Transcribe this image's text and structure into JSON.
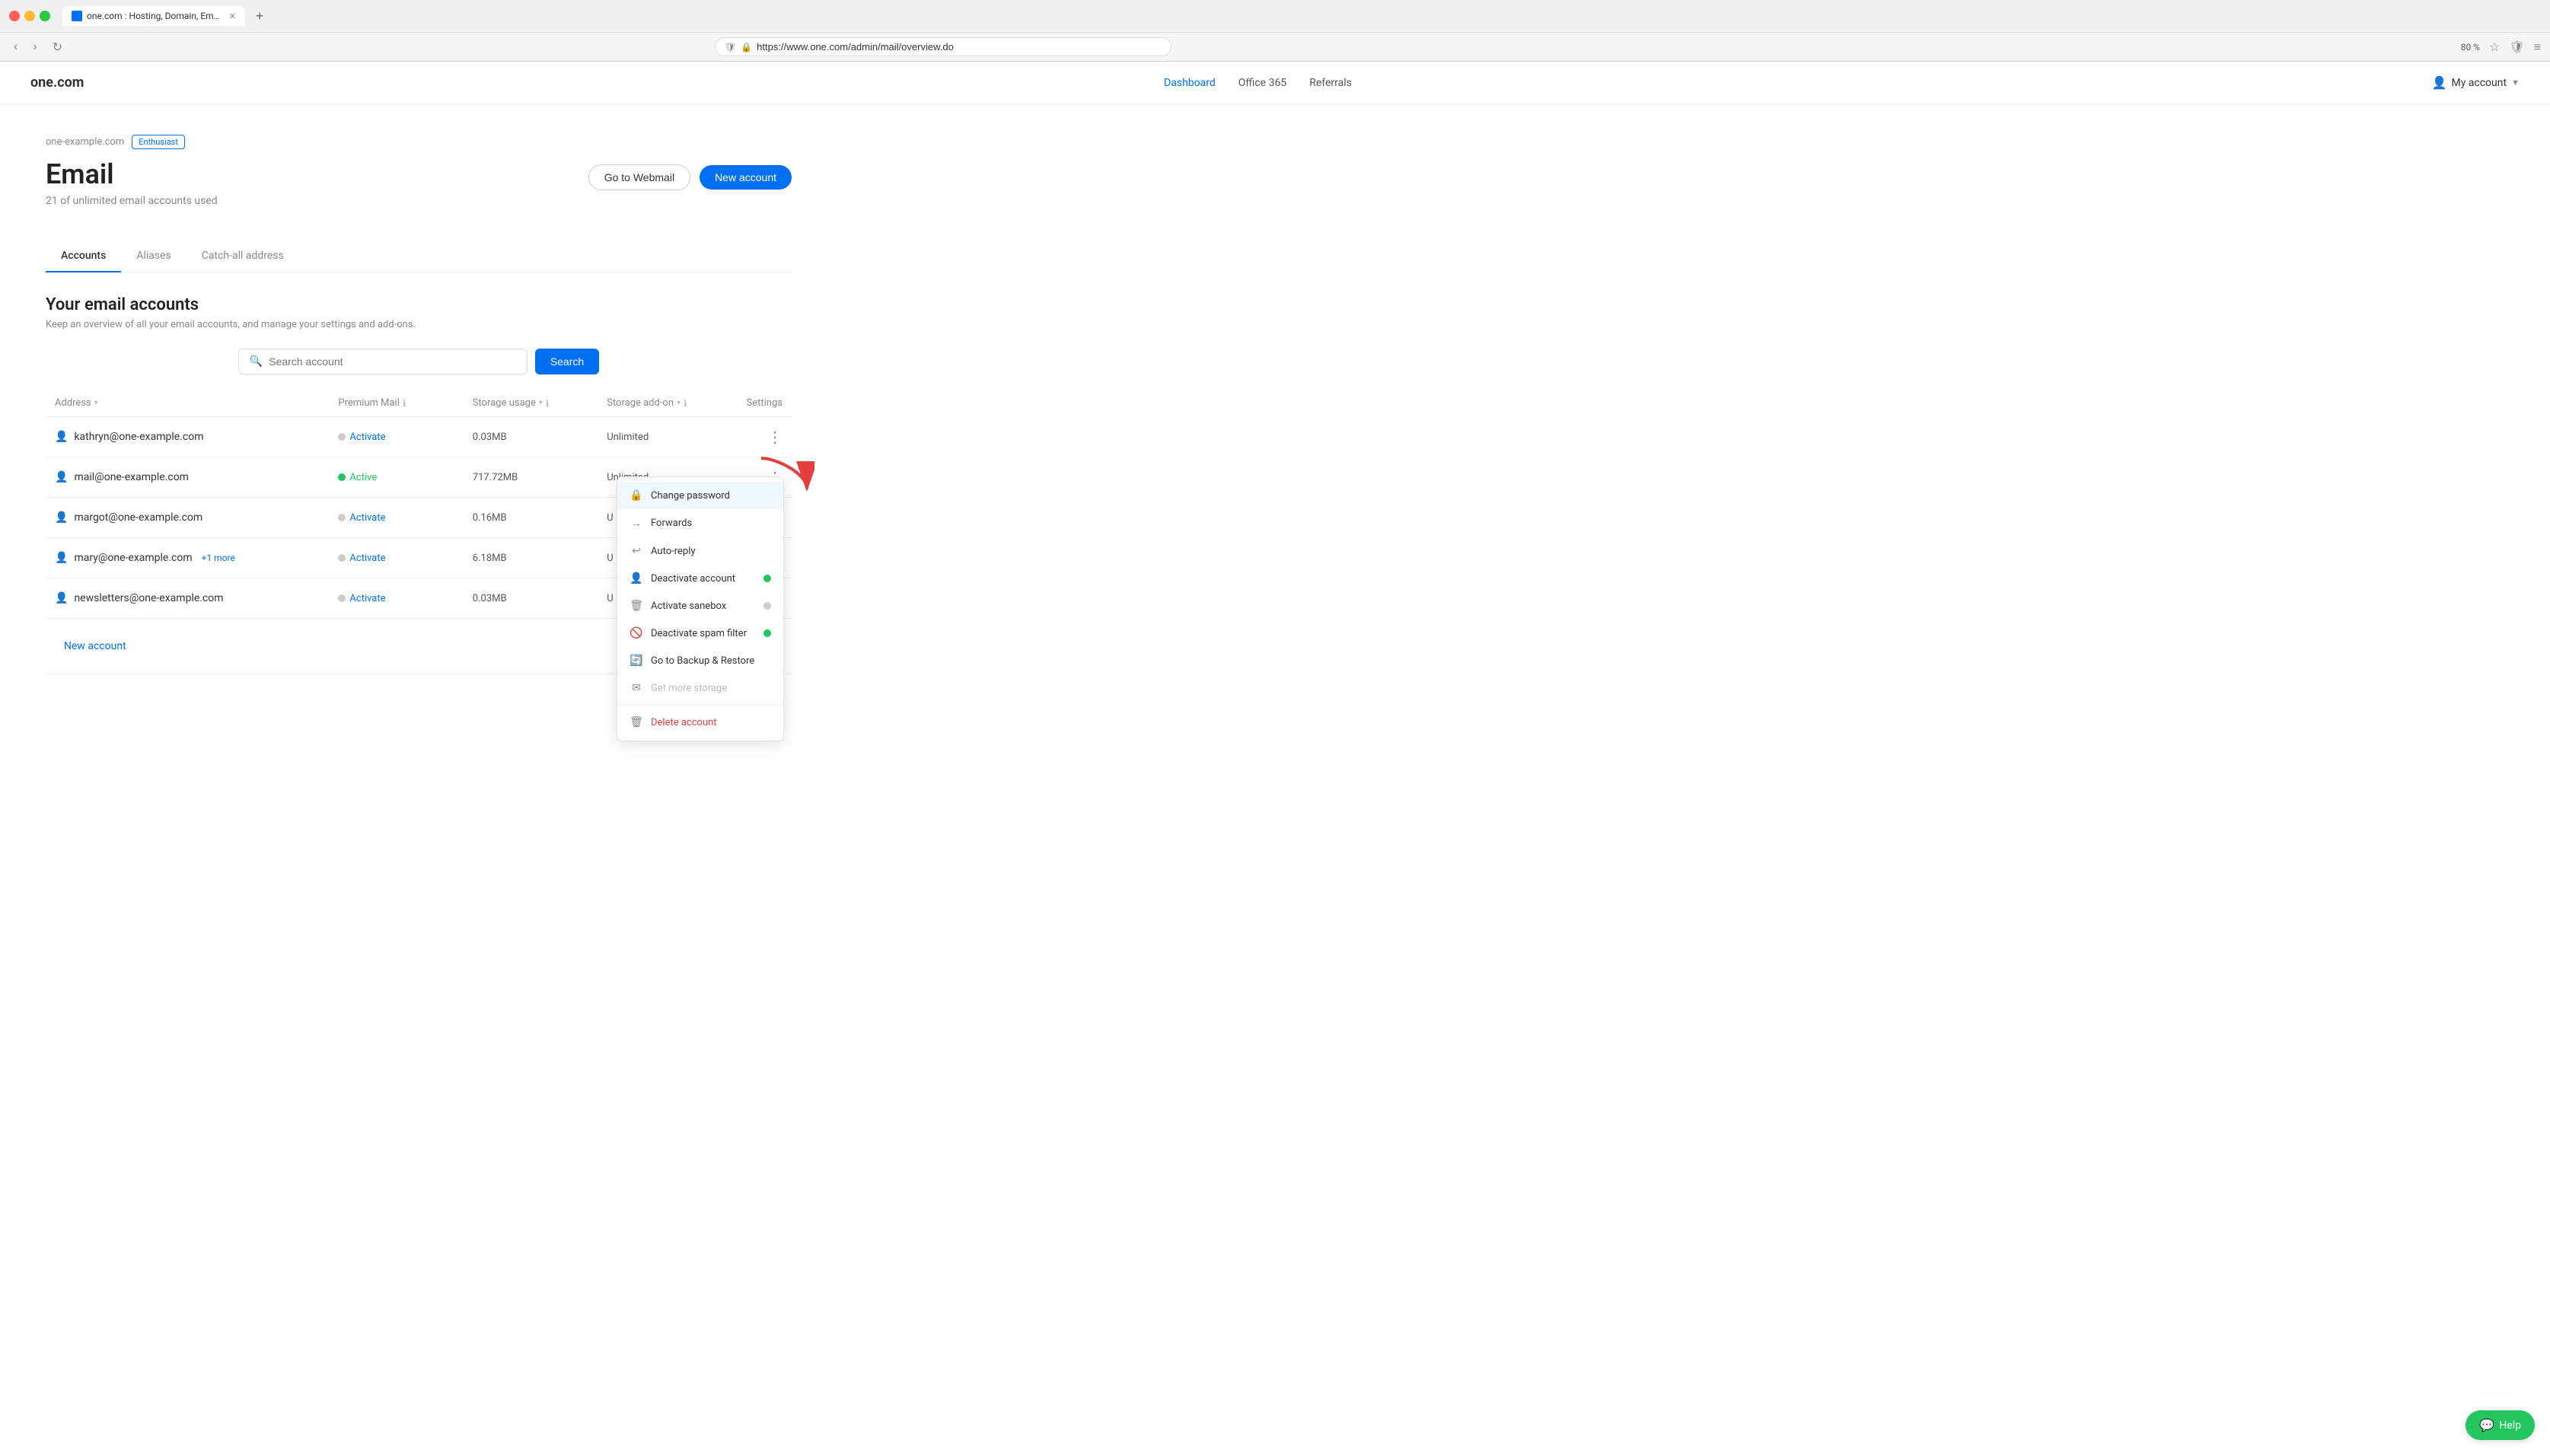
{
  "browser": {
    "tab_title": "one.com : Hosting, Domain, Em…",
    "url": "https://www.one.com/admin/mail/overview.do",
    "zoom": "80 %"
  },
  "nav": {
    "logo": "one.com",
    "links": [
      {
        "label": "Dashboard",
        "active": true
      },
      {
        "label": "Office 365",
        "active": false
      },
      {
        "label": "Referrals",
        "active": false
      }
    ],
    "my_account": "My account"
  },
  "header": {
    "domain": "one-example.com",
    "badge": "Enthusiast",
    "title": "Email",
    "subtitle": "21 of unlimited email accounts used",
    "btn_webmail": "Go to Webmail",
    "btn_new": "New account"
  },
  "tabs": [
    {
      "label": "Accounts",
      "active": true
    },
    {
      "label": "Aliases",
      "active": false
    },
    {
      "label": "Catch-all address",
      "active": false
    }
  ],
  "section": {
    "title": "Your email accounts",
    "subtitle": "Keep an overview of all your email accounts, and manage your settings and add-ons."
  },
  "search": {
    "placeholder": "Search account",
    "button": "Search"
  },
  "table": {
    "columns": [
      {
        "label": "Address",
        "sort": true
      },
      {
        "label": "Premium Mail",
        "info": true
      },
      {
        "label": "Storage usage",
        "info": true,
        "sort": true
      },
      {
        "label": "Storage add-on",
        "info": true,
        "sort": true
      },
      {
        "label": "Settings"
      }
    ],
    "rows": [
      {
        "email": "kathryn@one-example.com",
        "premium_status": "inactive",
        "premium_label": "Activate",
        "storage": "0.03MB",
        "addon": "Unlimited",
        "alias": null
      },
      {
        "email": "mail@one-example.com",
        "premium_status": "active",
        "premium_label": "Active",
        "storage": "717.72MB",
        "addon": "Unlimited",
        "alias": null,
        "show_menu": true
      },
      {
        "email": "margot@one-example.com",
        "premium_status": "inactive",
        "premium_label": "Activate",
        "storage": "0.16MB",
        "addon": "U",
        "alias": null
      },
      {
        "email": "mary@one-example.com",
        "premium_status": "inactive",
        "premium_label": "Activate",
        "storage": "6.18MB",
        "addon": "U",
        "alias": "+1 more"
      },
      {
        "email": "newsletters@one-example.com",
        "premium_status": "inactive",
        "premium_label": "Activate",
        "storage": "0.03MB",
        "addon": "U",
        "alias": null
      }
    ],
    "new_account": "New account"
  },
  "dropdown": {
    "items": [
      {
        "label": "Change password",
        "icon": "🔒",
        "toggle": null,
        "highlighted": true
      },
      {
        "label": "Forwards",
        "icon": "→",
        "toggle": null
      },
      {
        "label": "Auto-reply",
        "icon": "↩",
        "toggle": null
      },
      {
        "label": "Deactivate account",
        "icon": "👤",
        "toggle": "green"
      },
      {
        "label": "Activate sanebox",
        "icon": "🗑",
        "toggle": "gray"
      },
      {
        "label": "Deactivate spam filter",
        "icon": "🚫",
        "toggle": "green"
      },
      {
        "label": "Go to Backup & Restore",
        "icon": "🔄",
        "toggle": null
      },
      {
        "label": "Get more storage",
        "icon": "✉",
        "toggle": null,
        "disabled": true
      },
      {
        "label": "Delete account",
        "icon": "🗑",
        "toggle": null,
        "delete": true
      }
    ]
  },
  "help": {
    "label": "Help"
  }
}
